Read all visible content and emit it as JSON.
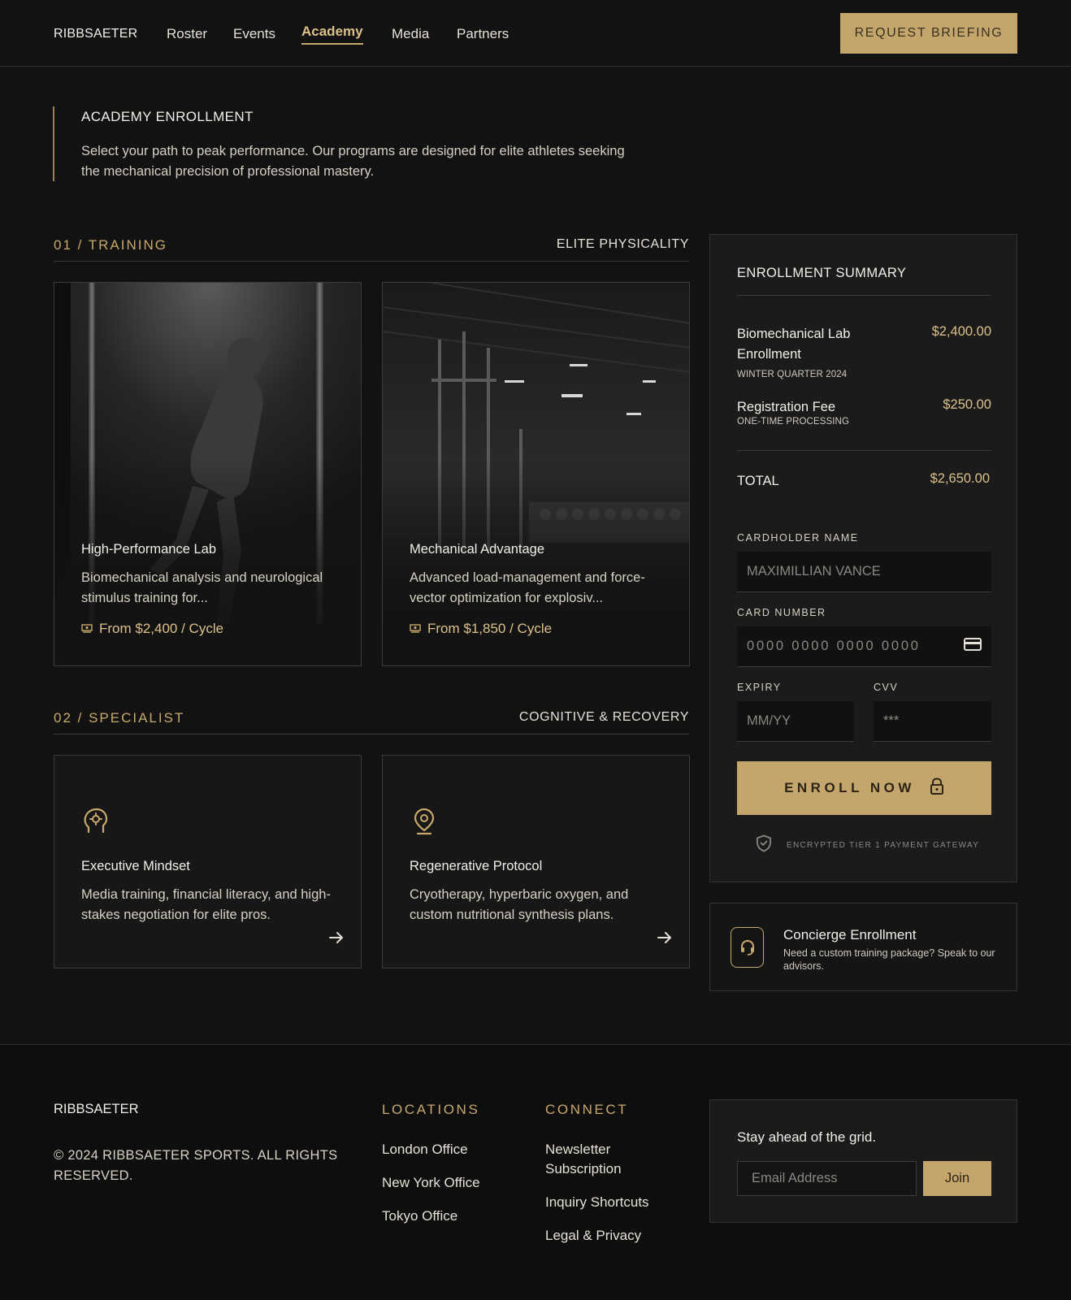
{
  "header": {
    "logo": "RIBBSAETER",
    "nav": [
      "Roster",
      "Events",
      "Academy",
      "Media",
      "Partners"
    ],
    "active_nav": "Academy",
    "cta": "REQUEST BRIEFING"
  },
  "intro": {
    "title": "ACADEMY ENROLLMENT",
    "description": "Select your path to peak performance. Our programs are designed for elite athletes seeking the mechanical precision of professional mastery."
  },
  "training": {
    "title": "01 / TRAINING",
    "subtitle": "ELITE PHYSICALITY",
    "cards": [
      {
        "title": "High-Performance Lab",
        "description": "Biomechanical analysis and neurological stimulus training for...",
        "price": "From $2,400 / Cycle",
        "image": "athlete-photo"
      },
      {
        "title": "Mechanical Advantage",
        "description": "Advanced load-management and force-vector optimization for explosiv...",
        "price": "From $1,850 / Cycle",
        "image": "gym-photo"
      }
    ]
  },
  "specialist": {
    "title": "02 / SPECIALIST",
    "subtitle": "COGNITIVE & RECOVERY",
    "cards": [
      {
        "icon": "mind-gear-icon",
        "title": "Executive Mindset",
        "description": "Media training, financial literacy, and high-stakes negotiation for elite pros."
      },
      {
        "icon": "location-pin-icon",
        "title": "Regenerative Protocol",
        "description": "Cryotherapy, hyperbaric oxygen, and custom nutritional synthesis plans."
      }
    ]
  },
  "summary": {
    "title": "ENROLLMENT SUMMARY",
    "items": [
      {
        "label": "Biomechanical Lab Enrollment",
        "sub": "WINTER QUARTER 2024",
        "price": "$2,400.00"
      },
      {
        "label": "Registration Fee",
        "sub": "ONE-TIME PROCESSING",
        "price": "$250.00"
      }
    ],
    "total_label": "TOTAL",
    "total_value": "$2,650.00",
    "cardholder_label": "CARDHOLDER NAME",
    "cardholder_placeholder": "MAXIMILLIAN VANCE",
    "card_number_label": "CARD NUMBER",
    "card_number_placeholder": "0000 0000 0000 0000",
    "expiry_label": "EXPIRY",
    "expiry_placeholder": "MM/YY",
    "cvv_label": "CVV",
    "cvv_placeholder": "***",
    "enroll_label": "ENROLL NOW",
    "secure_text": "ENCRYPTED TIER 1 PAYMENT GATEWAY"
  },
  "concierge": {
    "title": "Concierge Enrollment",
    "description": "Need a custom training package? Speak to our advisors."
  },
  "footer": {
    "logo": "RIBBSAETER",
    "copyright": "© 2024 RIBBSAETER SPORTS. ALL RIGHTS RESERVED.",
    "locations_title": "LOCATIONS",
    "locations": [
      "London Office",
      "New York Office",
      "Tokyo Office"
    ],
    "connect_title": "CONNECT",
    "connect": [
      "Newsletter Subscription",
      "Inquiry Shortcuts",
      "Legal & Privacy"
    ],
    "newsletter_title": "Stay ahead of the grid.",
    "email_placeholder": "Email Address",
    "join_label": "Join"
  },
  "colors": {
    "background": "#121212",
    "accent_gold": "#c4a66d",
    "panel": "#1b1b1b"
  }
}
